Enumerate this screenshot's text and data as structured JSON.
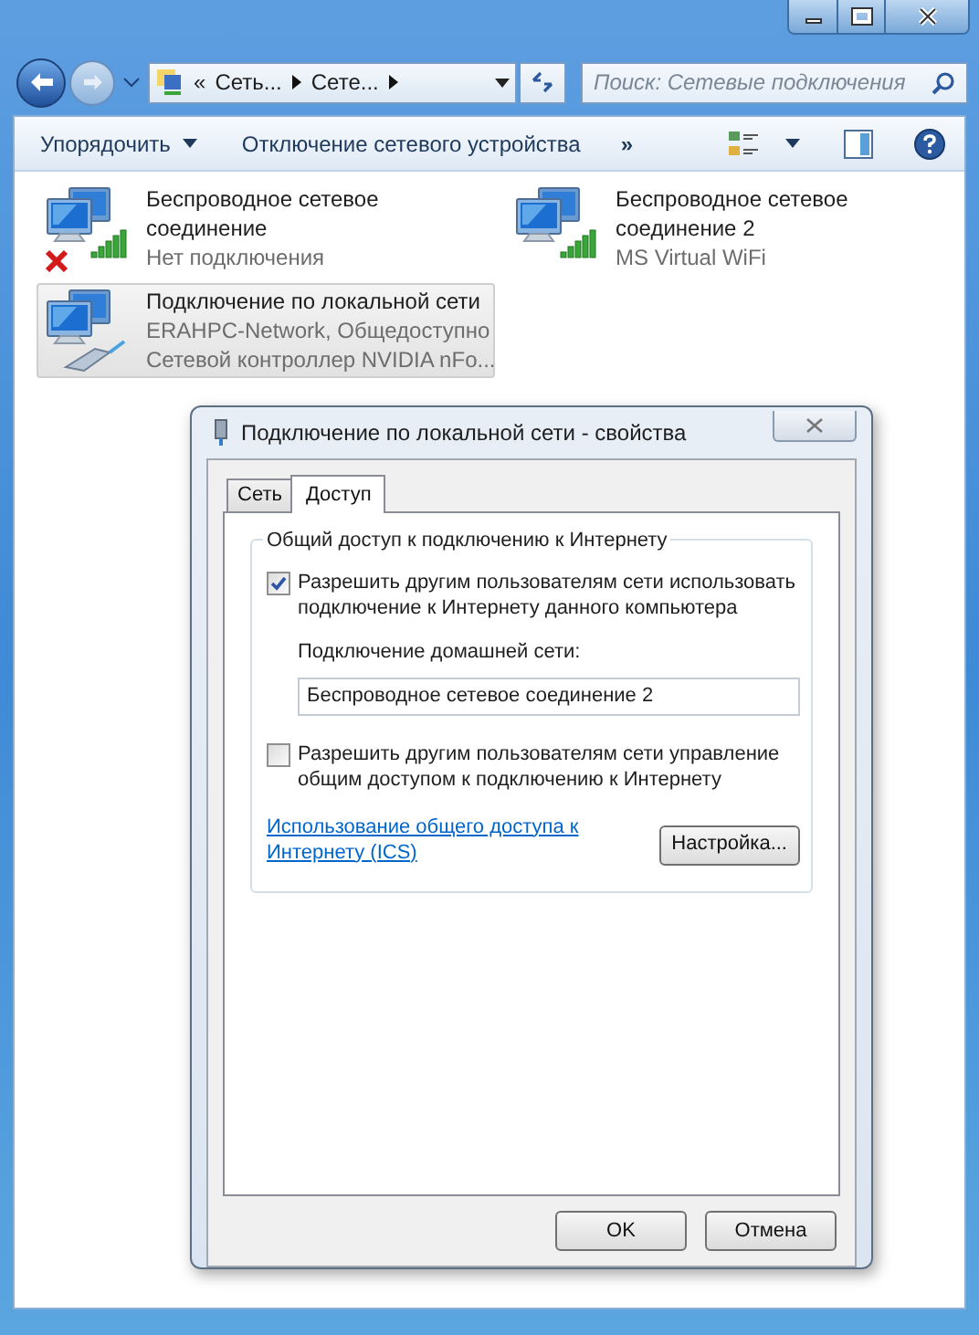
{
  "address_bar": {
    "prefix": "«",
    "crumbs": [
      "Сеть...",
      "Сете..."
    ]
  },
  "search": {
    "placeholder": "Поиск: Сетевые подключения"
  },
  "toolbar": {
    "items": [
      {
        "label": "Упорядочить",
        "kind": "dropdown"
      },
      {
        "label": "Отключение сетевого устройства",
        "kind": "command"
      },
      {
        "label": "»",
        "kind": "more"
      }
    ]
  },
  "connections": [
    {
      "name": "Беспроводное сетевое соединение",
      "kind": "wireless",
      "error": true,
      "selected": false,
      "details": [
        "Нет подключения"
      ]
    },
    {
      "name": "Беспроводное сетевое соединение 2",
      "kind": "wireless",
      "error": false,
      "selected": false,
      "details": [
        "MS Virtual WiFi"
      ]
    },
    {
      "name": "Подключение по локальной сети",
      "kind": "wired",
      "error": false,
      "selected": true,
      "details": [
        "ERAHPC-Network, Общедоступно",
        "Сетевой контроллер NVIDIA nFo..."
      ]
    }
  ],
  "dialog": {
    "title": "Подключение по локальной сети - свойства",
    "tabs": [
      {
        "label": "Сеть",
        "selected": false
      },
      {
        "label": "Доступ",
        "selected": true
      }
    ],
    "group_title": "Общий доступ к подключению к Интернету",
    "allow_sharing": {
      "label": "Разрешить другим пользователям сети использовать подключение к Интернету данного компьютера",
      "checked": true
    },
    "home_network": {
      "label": "Подключение домашней сети:",
      "value": "Беспроводное сетевое соединение 2"
    },
    "allow_control": {
      "label": "Разрешить другим пользователям сети управление общим доступом к подключению к Интернету",
      "checked": false
    },
    "help_link": "Использование общего доступа к Интернету (ICS)",
    "settings_button": "Настройка...",
    "buttons": [
      "OK",
      "Отмена"
    ]
  }
}
